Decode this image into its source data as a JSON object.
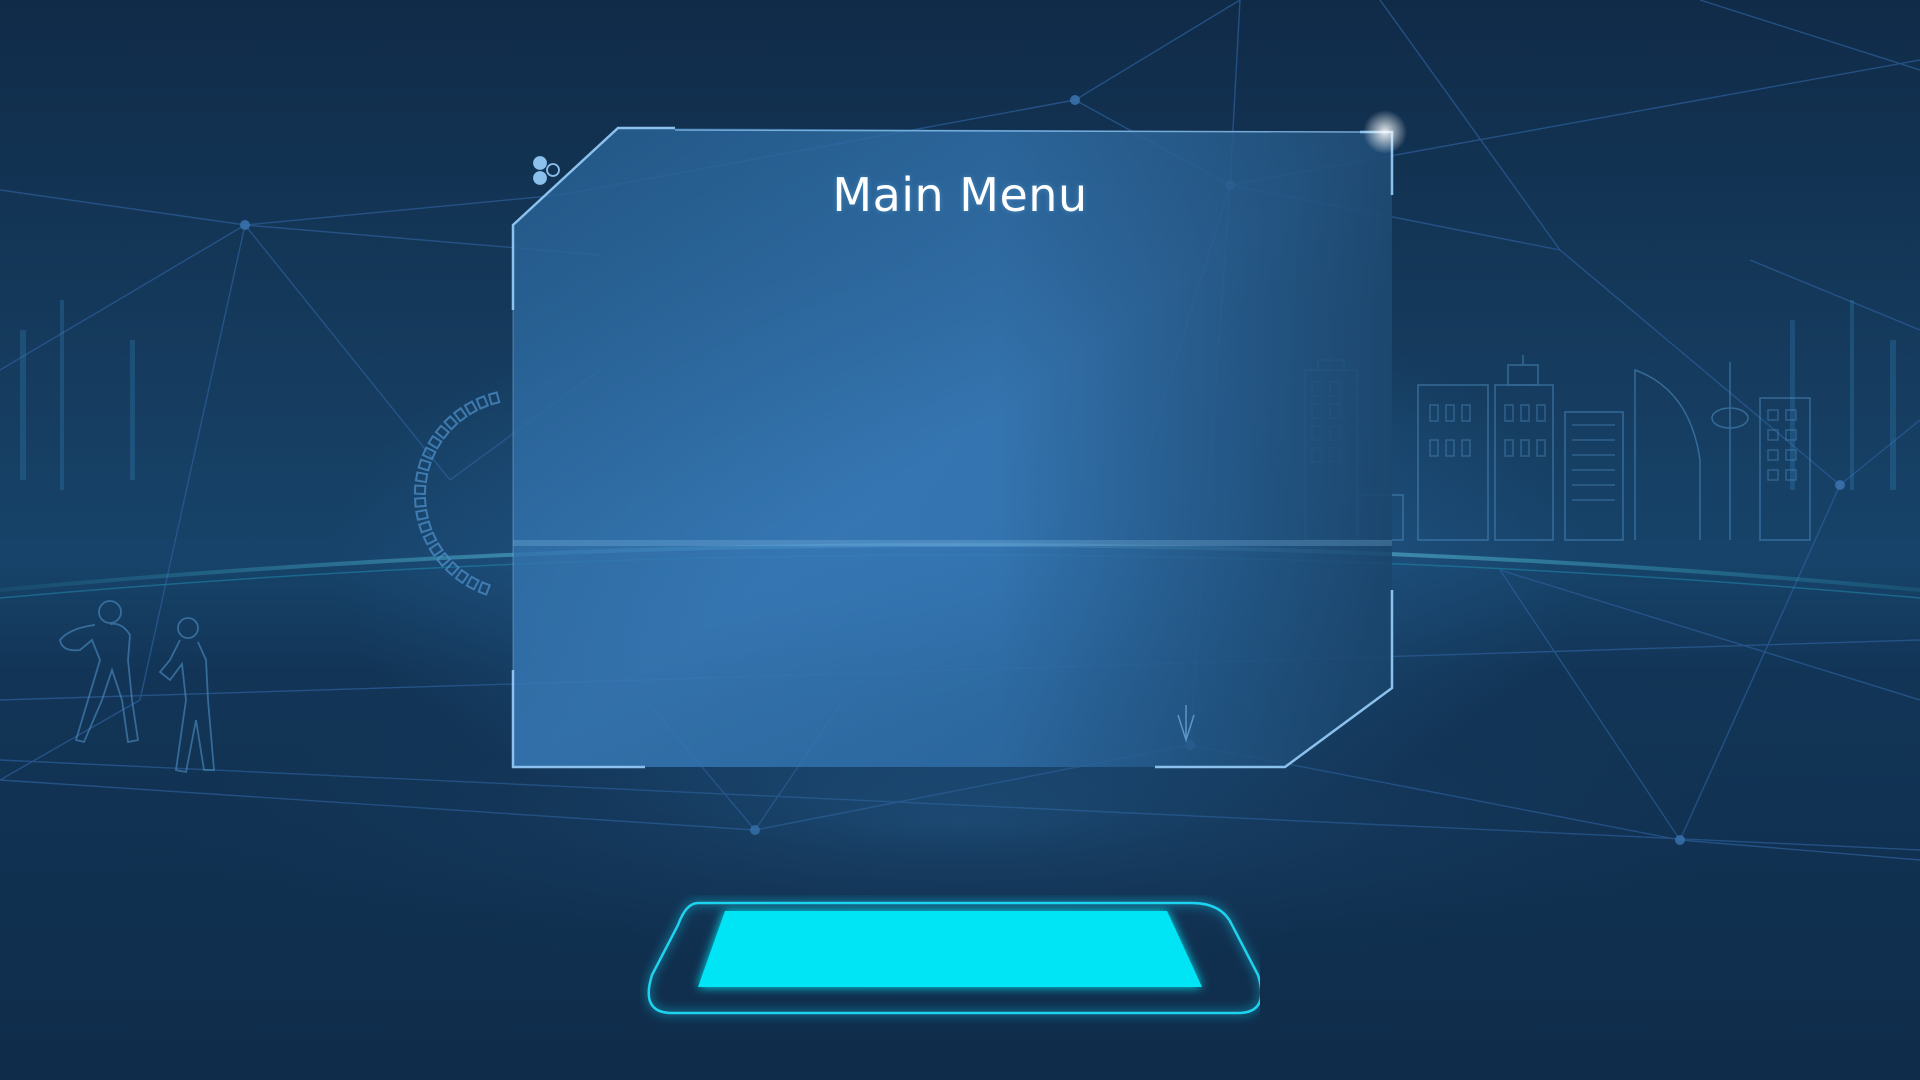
{
  "screen": {
    "title": "Main Menu"
  },
  "theme": {
    "background": "#0f2d4a",
    "panel_fill": "#2e6ea8",
    "panel_border": "#7fb8e8",
    "accent_cyan": "#00e5f5",
    "line_color": "#2b6aa8"
  },
  "icons": {
    "corner_dots": "hex-dots-icon",
    "start_pad": "hologram-pad-icon",
    "players": "boxers-silhouette-icon",
    "city": "city-skyline-icon",
    "dial": "segmented-ring-icon"
  }
}
